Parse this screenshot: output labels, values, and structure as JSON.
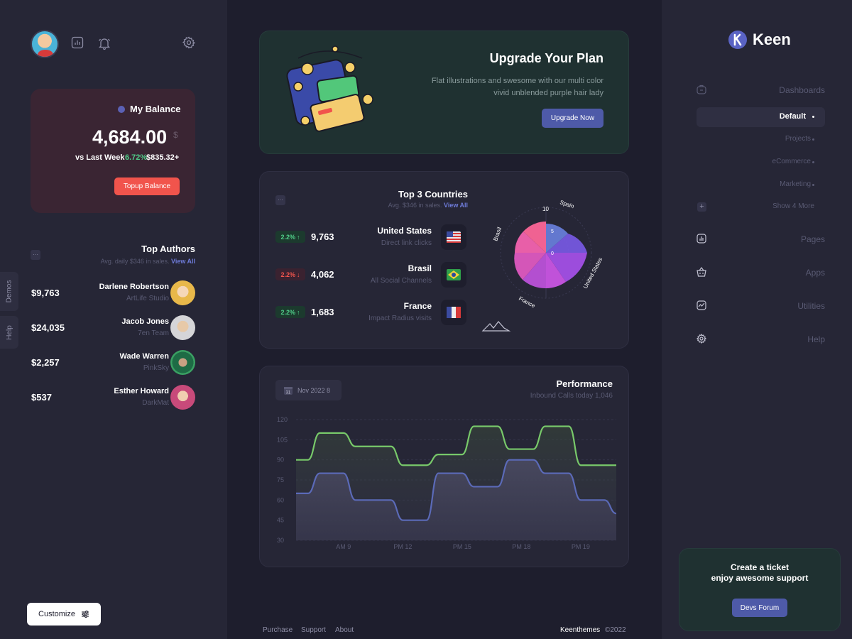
{
  "left": {
    "balance": {
      "title": "My Balance",
      "amount": "4,684.00",
      "currency": "$",
      "vs_label": "vs Last Week",
      "percent": "6.72%",
      "change": "$835.32+",
      "button": "Topup Balance"
    },
    "authors": {
      "title": "Top Authors",
      "subtitle": "Avg. daily $346 in sales.",
      "view_all": "View All",
      "items": [
        {
          "amount": "$9,763",
          "name": "Darlene Robertson",
          "company": "ArtLife Studio"
        },
        {
          "amount": "$24,035",
          "name": "Jacob Jones",
          "company": "7en Team"
        },
        {
          "amount": "$2,257",
          "name": "Wade Warren",
          "company": "PinkSky"
        },
        {
          "amount": "$537",
          "name": "Esther Howard",
          "company": "DarkMat"
        }
      ]
    },
    "tabs": {
      "demos": "Demos",
      "help": "Help"
    },
    "customize": "Customize",
    "icons": [
      "user-avatar",
      "chart-icon",
      "bell-icon",
      "gear-icon",
      "settings-sliders-icon"
    ]
  },
  "upgrade": {
    "title": "Upgrade Your Plan",
    "text_line1": "Flat illustrations and swesome with our multi color",
    "text_line2": "vivid unblended purple hair lady",
    "button": "Upgrade Now"
  },
  "countries": {
    "title": "Top 3 Countries",
    "subtitle": "Avg. $346 in sales.",
    "view_all": "View All",
    "items": [
      {
        "badge": "2.2%",
        "trend": "up",
        "value": "9,763",
        "name": "United States",
        "source": "Direct link clicks"
      },
      {
        "badge": "2.2%",
        "trend": "down",
        "value": "4,062",
        "name": "Brasil",
        "source": "All Social Channels"
      },
      {
        "badge": "2.2%",
        "trend": "up",
        "value": "1,683",
        "name": "France",
        "source": "Impact Radius visits"
      }
    ],
    "radar_labels": {
      "spain": "Spain",
      "brasil": "Brasil",
      "us": "United States",
      "france": "France",
      "ten": "10",
      "five": "5",
      "zero": "0"
    }
  },
  "performance": {
    "date": "Nov 2022 8",
    "calendar_day": "31",
    "title": "Performance",
    "subtitle": "Inbound Calls today 1,046"
  },
  "chart_data": {
    "type": "area",
    "title": "Performance",
    "x": [
      "AM 9",
      "PM 12",
      "PM 15",
      "PM 18",
      "PM 19"
    ],
    "ylim": [
      30,
      120
    ],
    "yticks": [
      120,
      105,
      90,
      75,
      60,
      45,
      30
    ],
    "grid": true,
    "series": [
      {
        "color": "#78c96a",
        "points": [
          [
            0,
            90
          ],
          [
            1,
            90
          ],
          [
            2,
            110
          ],
          [
            3,
            110
          ],
          [
            4,
            110
          ],
          [
            5,
            100
          ],
          [
            6,
            100
          ],
          [
            7,
            100
          ],
          [
            8,
            100
          ],
          [
            9,
            86
          ],
          [
            10,
            86
          ],
          [
            11,
            86
          ],
          [
            12,
            94
          ],
          [
            13,
            94
          ],
          [
            14,
            94
          ],
          [
            15,
            115
          ],
          [
            16,
            115
          ],
          [
            17,
            115
          ],
          [
            18,
            98
          ],
          [
            19,
            98
          ],
          [
            20,
            98
          ],
          [
            21,
            115
          ],
          [
            22,
            115
          ],
          [
            23,
            115
          ],
          [
            24,
            86
          ],
          [
            25,
            86
          ],
          [
            26,
            86
          ],
          [
            27,
            86
          ]
        ]
      },
      {
        "color": "#5b6ab8",
        "points": [
          [
            0,
            65
          ],
          [
            1,
            65
          ],
          [
            2,
            80
          ],
          [
            3,
            80
          ],
          [
            4,
            80
          ],
          [
            5,
            60
          ],
          [
            6,
            60
          ],
          [
            7,
            60
          ],
          [
            8,
            60
          ],
          [
            9,
            45
          ],
          [
            10,
            45
          ],
          [
            11,
            45
          ],
          [
            12,
            80
          ],
          [
            13,
            80
          ],
          [
            14,
            80
          ],
          [
            15,
            70
          ],
          [
            16,
            70
          ],
          [
            17,
            70
          ],
          [
            18,
            90
          ],
          [
            19,
            90
          ],
          [
            20,
            90
          ],
          [
            21,
            80
          ],
          [
            22,
            80
          ],
          [
            23,
            80
          ],
          [
            24,
            60
          ],
          [
            25,
            60
          ],
          [
            26,
            60
          ],
          [
            27,
            50
          ]
        ]
      }
    ]
  },
  "right": {
    "brand": "Keen",
    "nav": {
      "dashboards": "Dashboards",
      "default": "Default",
      "projects": "Projects",
      "ecommerce": "eCommerce",
      "marketing": "Marketing",
      "show_more": "Show 4 More",
      "pages": "Pages",
      "apps": "Apps",
      "utilities": "Utilities",
      "help": "Help"
    },
    "ticket": {
      "line1": "Create a ticket",
      "line2": "enjoy awesome support",
      "button": "Devs Forum"
    }
  },
  "footer": {
    "purchase": "Purchase",
    "support": "Support",
    "about": "About",
    "brand": "Keenthemes",
    "year": "©2022"
  }
}
